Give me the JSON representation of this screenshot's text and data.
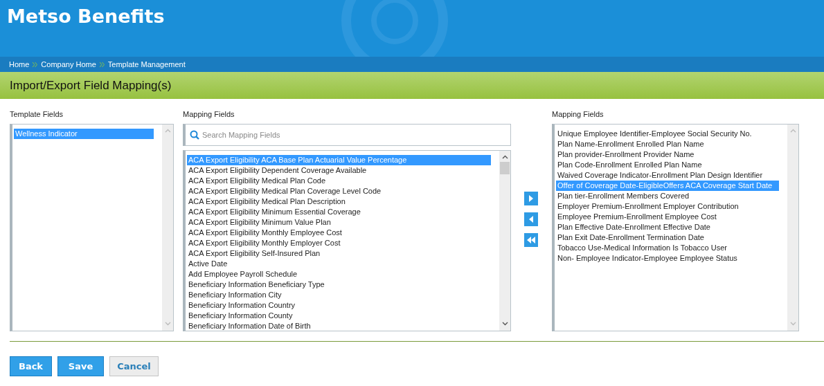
{
  "header": {
    "title": "Metso Benefits"
  },
  "breadcrumb": [
    "Home",
    "Company Home",
    "Template Management"
  ],
  "page_title": "Import/Export Field Mapping(s)",
  "template_fields": {
    "label": "Template Fields",
    "items": [
      {
        "text": "Wellness Indicator",
        "selected": true
      }
    ]
  },
  "mapping_fields": {
    "label": "Mapping Fields",
    "search": {
      "placeholder": "Search Mapping Fields"
    },
    "items": [
      {
        "text": "ACA Export Eligibility ACA Base Plan Actuarial Value Percentage",
        "selected": true
      },
      {
        "text": "ACA Export Eligibility Dependent Coverage Available",
        "selected": false
      },
      {
        "text": "ACA Export Eligibility Medical Plan Code",
        "selected": false
      },
      {
        "text": "ACA Export Eligibility Medical Plan Coverage Level Code",
        "selected": false
      },
      {
        "text": "ACA Export Eligibility Medical Plan Description",
        "selected": false
      },
      {
        "text": "ACA Export Eligibility Minimum Essential Coverage",
        "selected": false
      },
      {
        "text": "ACA Export Eligibility Minimum Value Plan",
        "selected": false
      },
      {
        "text": "ACA Export Eligibility Monthly Employee Cost",
        "selected": false
      },
      {
        "text": "ACA Export Eligibility Monthly Employer Cost",
        "selected": false
      },
      {
        "text": "ACA Export Eligibility Self-Insured Plan",
        "selected": false
      },
      {
        "text": "Active Date",
        "selected": false
      },
      {
        "text": "Add Employee Payroll Schedule",
        "selected": false
      },
      {
        "text": "Beneficiary Information Beneficiary Type",
        "selected": false
      },
      {
        "text": "Beneficiary Information City",
        "selected": false
      },
      {
        "text": "Beneficiary Information Country",
        "selected": false
      },
      {
        "text": "Beneficiary Information County",
        "selected": false
      },
      {
        "text": "Beneficiary Information Date of Birth",
        "selected": false
      }
    ]
  },
  "mapped_fields": {
    "label": "Mapping Fields",
    "items": [
      {
        "text": "Unique Employee Identifier-Employee Social Security No.",
        "selected": false
      },
      {
        "text": "Plan Name-Enrollment Enrolled Plan Name",
        "selected": false
      },
      {
        "text": "Plan provider-Enrollment Provider Name",
        "selected": false
      },
      {
        "text": "Plan Code-Enrollment Enrolled Plan Name",
        "selected": false
      },
      {
        "text": "Waived Coverage Indicator-Enrollment Plan Design Identifier",
        "selected": false
      },
      {
        "text": "Offer of Coverage Date-EligibleOffers ACA Coverage Start Date",
        "selected": true
      },
      {
        "text": "Plan tier-Enrollment Members Covered",
        "selected": false
      },
      {
        "text": "Employer Premium-Enrollment Employer Contribution",
        "selected": false
      },
      {
        "text": "Employee Premium-Enrollment Employee Cost",
        "selected": false
      },
      {
        "text": "Plan Effective Date-Enrollment Effective Date",
        "selected": false
      },
      {
        "text": "Plan Exit Date-Enrollment Termination Date",
        "selected": false
      },
      {
        "text": "Tobacco Use-Medical Information Is Tobacco User",
        "selected": false
      },
      {
        "text": "Non- Employee Indicator-Employee Employee Status",
        "selected": false
      }
    ]
  },
  "buttons": [
    {
      "label": "Back",
      "kind": "primary"
    },
    {
      "label": "Save",
      "kind": "primary"
    },
    {
      "label": "Cancel",
      "kind": "secondary"
    }
  ]
}
